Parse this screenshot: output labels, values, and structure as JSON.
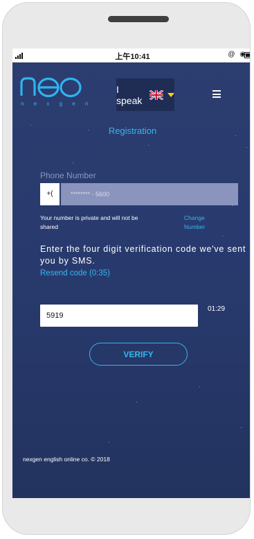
{
  "status_bar": {
    "time": "上午10:41",
    "icons": "@ ◉"
  },
  "header": {
    "logo_text": "neo",
    "logo_subtitle": "n e x g e n",
    "language_label": "I speak",
    "language_flag": "uk-flag-icon",
    "menu_icon": "hamburger-menu-icon"
  },
  "registration": {
    "title": "Registration",
    "phone_label": "Phone Number",
    "phone_prefix": "+(",
    "phone_value": "******** - 5600",
    "private_note": "Your number is private and will not be shared",
    "change_number": "Change Number",
    "instruction": "Enter the four digit verification code we've sent you by SMS.",
    "resend": "Resend code (0:35)",
    "code_value": "5919",
    "timer": "01:29",
    "verify_label": "VERIFY"
  },
  "footer": {
    "copyright": "nexgen english online co. © 2018"
  },
  "colors": {
    "background": "#2a3b6e",
    "accent": "#33b7ee",
    "lang_box": "#1f2d55",
    "phone_field": "#8a94bc",
    "caret": "#f3d51a"
  }
}
